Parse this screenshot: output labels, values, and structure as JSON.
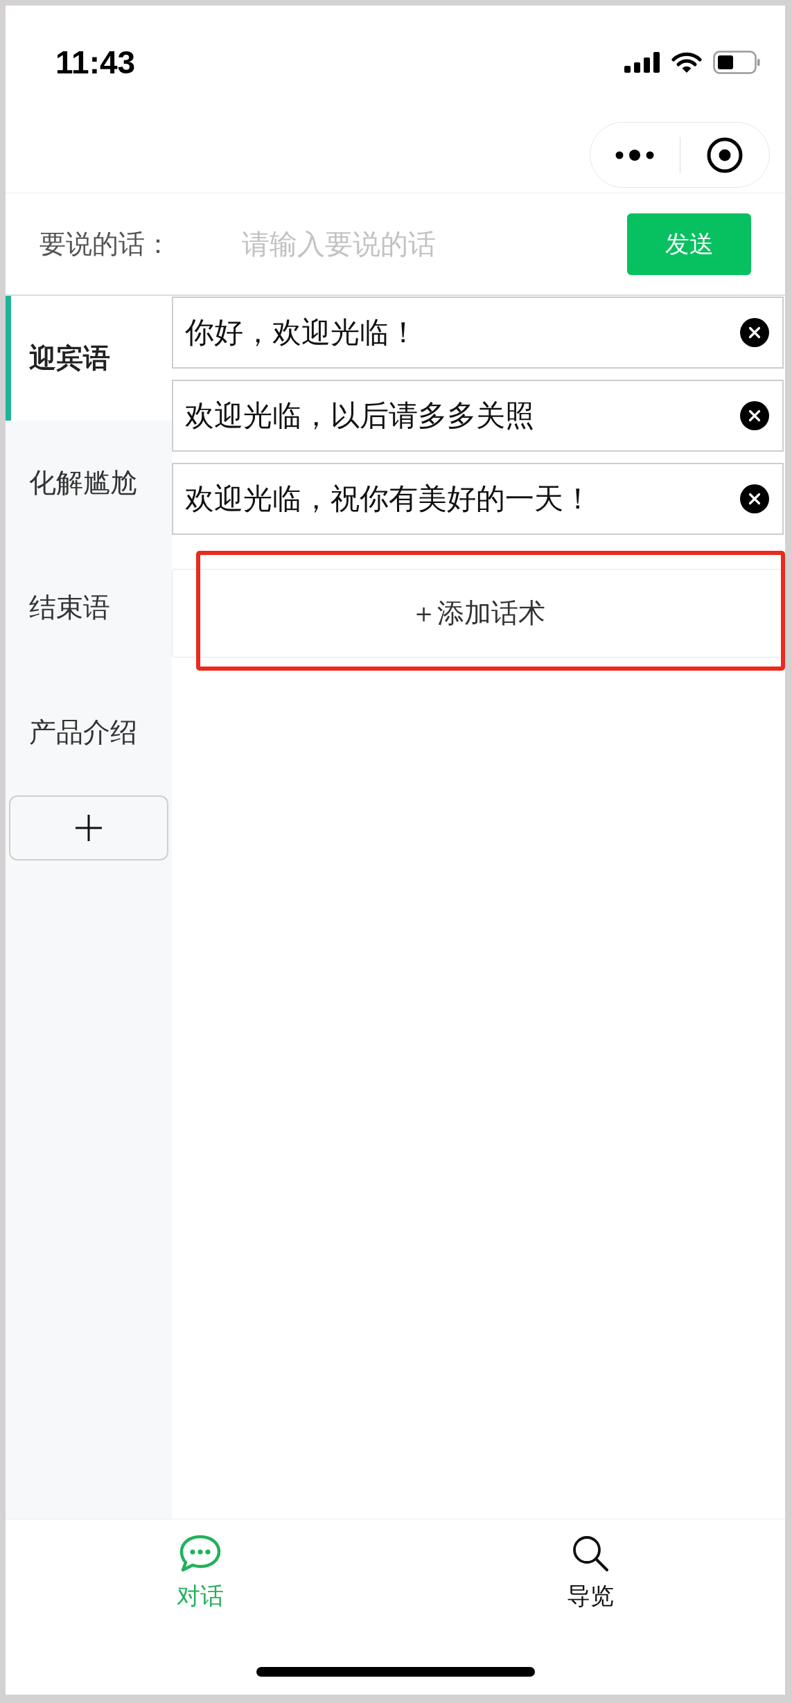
{
  "status_bar": {
    "time": "11:43"
  },
  "message_bar": {
    "label": "要说的话：",
    "placeholder": "请输入要说的话",
    "send_button": "发送"
  },
  "sidebar": {
    "items": [
      {
        "label": "迎宾语",
        "selected": true
      },
      {
        "label": "化解尴尬",
        "selected": false
      },
      {
        "label": "结束语",
        "selected": false
      },
      {
        "label": "产品介绍",
        "selected": false
      }
    ]
  },
  "phrases": [
    {
      "text": "你好，欢迎光临！"
    },
    {
      "text": "欢迎光临，以后请多多关照"
    },
    {
      "text": "欢迎光临，祝你有美好的一天！"
    }
  ],
  "add_phrase": {
    "label": "＋添加话术",
    "highlighted": true
  },
  "tab_bar": {
    "tabs": [
      {
        "label": "对话",
        "kind": "chat",
        "selected": true
      },
      {
        "label": "导览",
        "kind": "search",
        "selected": false
      }
    ]
  }
}
